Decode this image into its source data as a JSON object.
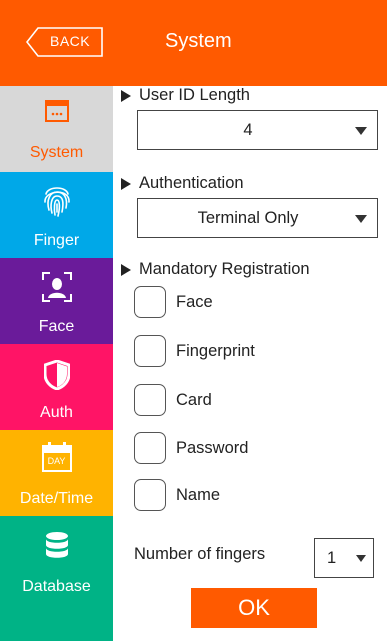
{
  "header": {
    "back_label": "BACK",
    "title": "System",
    "back_icon": "chevron-left-icon"
  },
  "sidebar": {
    "items": [
      {
        "label": "System",
        "icon": "window-icon"
      },
      {
        "label": "Finger",
        "icon": "fingerprint-icon"
      },
      {
        "label": "Face",
        "icon": "face-scan-icon"
      },
      {
        "label": "Auth",
        "icon": "shield-icon"
      },
      {
        "label": "Date/Time",
        "icon": "calendar-icon",
        "icon_text": "DAY"
      },
      {
        "label": "Database",
        "icon": "database-icon"
      }
    ]
  },
  "main": {
    "user_id_length": {
      "title": "User ID Length",
      "value": "4"
    },
    "authentication": {
      "title": "Authentication",
      "value": "Terminal Only"
    },
    "mandatory_registration": {
      "title": "Mandatory Registration",
      "options": [
        {
          "label": "Face",
          "checked": false
        },
        {
          "label": "Fingerprint",
          "checked": false
        },
        {
          "label": "Card",
          "checked": false
        },
        {
          "label": "Password",
          "checked": false
        },
        {
          "label": "Name",
          "checked": false
        }
      ]
    },
    "number_of_fingers": {
      "label": "Number of fingers",
      "value": "1"
    },
    "ok_label": "OK"
  },
  "colors": {
    "accent": "#ff5a00",
    "finger": "#00a8e8",
    "face": "#6a1b9a",
    "auth": "#ff1466",
    "datetime": "#ffb300",
    "database": "#00b386",
    "sidebar_selected": "#d8d8d8"
  }
}
